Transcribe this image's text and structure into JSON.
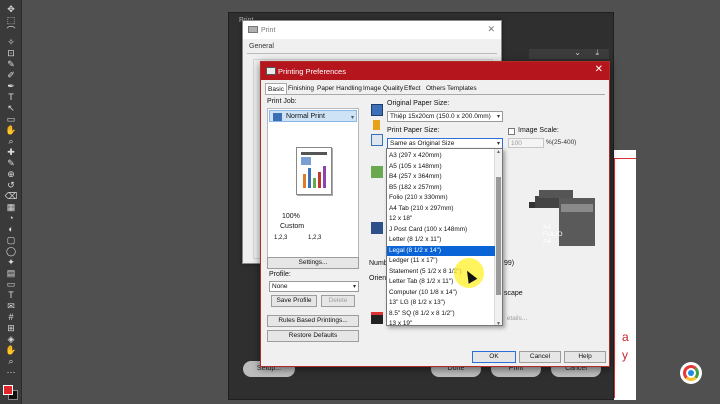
{
  "photoshop": {
    "tools": [
      "move-icon",
      "marquee-icon",
      "lasso-icon",
      "magic-wand-icon",
      "crop-icon",
      "eyedropper-icon",
      "brush-icon",
      "pen-icon",
      "type-icon",
      "path-select-icon",
      "rectangle-icon",
      "hand-icon",
      "zoom-icon",
      "healing-icon",
      "brush2-icon",
      "stamp-icon",
      "history-icon",
      "eraser-icon",
      "gradient-icon",
      "blur-icon",
      "dodge-icon",
      "frame-icon",
      "ellipse-icon",
      "shape-icon",
      "gradient2-icon",
      "rect2-icon",
      "type2-icon",
      "note-icon",
      "count-icon",
      "grid-icon",
      "3d-icon",
      "hand2-icon",
      "zoom2-icon",
      "more-icon"
    ],
    "fill_color": "#e0252a",
    "stroke_color": "#111111"
  },
  "print_window_bg": {
    "title": "Print",
    "setup_button": "Setup...",
    "done_button": "Done",
    "print_button": "Print",
    "cancel_button": "Cancel"
  },
  "canvas_paper": {
    "text_a": "a",
    "text_y": "y"
  },
  "print_dialog": {
    "title": "Print",
    "general_tab": "General"
  },
  "prefs": {
    "title": "Printing Preferences",
    "tabs": [
      "Basic",
      "Finishing",
      "Paper Handling",
      "Image Quality",
      "Effect",
      "Others",
      "Templates"
    ],
    "print_job_label": "Print Job:",
    "print_job_value": "Normal Print",
    "scale_value": "100%",
    "custom_label": "Custom",
    "order_left": "1,2,3",
    "order_right": "1,2,3",
    "settings_button": "Settings...",
    "profile_label": "Profile:",
    "profile_value": "None",
    "save_profile_button": "Save Profile",
    "delete_button": "Delete",
    "rules_button": "Rules Based Printings...",
    "restore_button": "Restore Defaults",
    "original_paper_size_label": "Original Paper Size:",
    "original_paper_size_value": "Thiệp 15x20cm (150.0 x 200.0mm)",
    "print_paper_size_label": "Print Paper Size:",
    "print_paper_size_value": "Same as Original Size",
    "image_scale_label": "Image Scale:",
    "image_scale_value": "100",
    "image_scale_range": "%(25-400)",
    "number_label": "Numb",
    "number_value": "99)",
    "orient_label": "Orient",
    "landscape_label": "scape",
    "details_button": "etails...",
    "printer_labels": [
      "A4",
      "FOLIO",
      "A4"
    ],
    "ok_button": "OK",
    "cancel_button": "Cancel",
    "help_button": "Help"
  },
  "paper_list": {
    "items": [
      "A3 (297 x 420mm)",
      "A5 (105 x 148mm)",
      "B4 (257 x 364mm)",
      "B5 (182 x 257mm)",
      "Folio (210 x 330mm)",
      "A4 Tab (210 x 297mm)",
      "12 x 18\"",
      "J Post Card (100 x 148mm)",
      "Letter (8 1/2 x 11\")",
      "Legal (8 1/2 x 14\")",
      "Ledger (11 x 17\")",
      "Statement (5 1/2 x 8 1/2\")",
      "Letter Tab (8 1/2 x 11\")",
      "Computer (10 1/8 x 14\")",
      "13\" LG (8 1/2 x 13\")",
      "8.5\" SQ (8 1/2 x 8 1/2\")",
      "13 x 19\""
    ],
    "selected_index": 9
  },
  "colors": {
    "prefs_title_bar": "#b5161e",
    "selection": "#0a64d6",
    "canvas_red": "#c2262d"
  }
}
